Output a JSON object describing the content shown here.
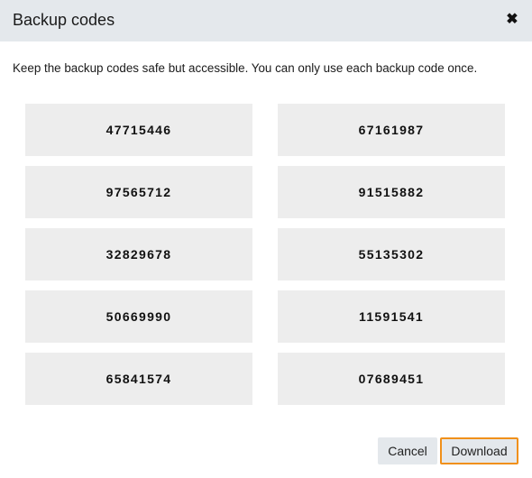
{
  "dialog": {
    "title": "Backup codes",
    "close_icon": "close-x-icon",
    "description": "Keep the backup codes safe but accessible. You can only use each backup code once.",
    "codes": [
      "47715446",
      "67161987",
      "97565712",
      "91515882",
      "32829678",
      "55135302",
      "50669990",
      "11591541",
      "65841574",
      "07689451"
    ],
    "buttons": {
      "cancel_label": "Cancel",
      "download_label": "Download"
    },
    "colors": {
      "header_bg": "#e4e8ec",
      "code_bg": "#ededed",
      "focus_ring": "#f0901a"
    }
  }
}
